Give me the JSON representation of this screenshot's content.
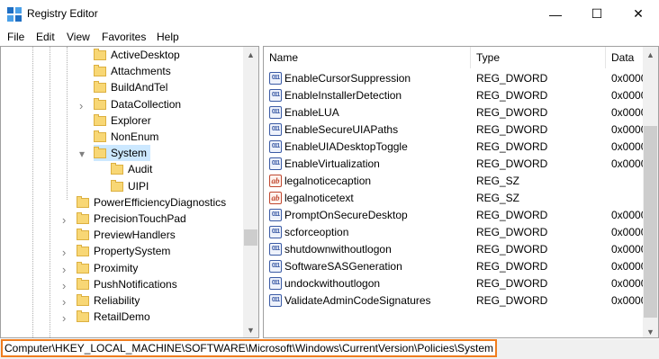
{
  "window": {
    "title": "Registry Editor",
    "minimize_glyph": "—",
    "maximize_glyph": "☐",
    "close_glyph": "✕"
  },
  "menu": [
    "File",
    "Edit",
    "View",
    "Favorites",
    "Help"
  ],
  "tree": {
    "items": [
      {
        "label": "ActiveDesktop",
        "expander": ""
      },
      {
        "label": "Attachments",
        "expander": ""
      },
      {
        "label": "BuildAndTel",
        "expander": ""
      },
      {
        "label": "DataCollection",
        "expander": ">"
      },
      {
        "label": "Explorer",
        "expander": ""
      },
      {
        "label": "NonEnum",
        "expander": ""
      },
      {
        "label": "System",
        "expander": "v",
        "selected": true
      },
      {
        "label": "Audit",
        "expander": ""
      },
      {
        "label": "UIPI",
        "expander": ""
      },
      {
        "label": "PowerEfficiencyDiagnostics",
        "expander": ""
      },
      {
        "label": "PrecisionTouchPad",
        "expander": ">"
      },
      {
        "label": "PreviewHandlers",
        "expander": ""
      },
      {
        "label": "PropertySystem",
        "expander": ">"
      },
      {
        "label": "Proximity",
        "expander": ">"
      },
      {
        "label": "PushNotifications",
        "expander": ">"
      },
      {
        "label": "Reliability",
        "expander": ">"
      },
      {
        "label": "RetailDemo",
        "expander": ">"
      }
    ]
  },
  "list": {
    "columns": [
      "Name",
      "Type",
      "Data"
    ],
    "rows": [
      {
        "name": "EnableCursorSuppression",
        "type": "REG_DWORD",
        "data": "0x0000",
        "icon": "dword"
      },
      {
        "name": "EnableInstallerDetection",
        "type": "REG_DWORD",
        "data": "0x0000",
        "icon": "dword"
      },
      {
        "name": "EnableLUA",
        "type": "REG_DWORD",
        "data": "0x0000",
        "icon": "dword"
      },
      {
        "name": "EnableSecureUIAPaths",
        "type": "REG_DWORD",
        "data": "0x0000",
        "icon": "dword"
      },
      {
        "name": "EnableUIADesktopToggle",
        "type": "REG_DWORD",
        "data": "0x0000",
        "icon": "dword"
      },
      {
        "name": "EnableVirtualization",
        "type": "REG_DWORD",
        "data": "0x0000",
        "icon": "dword"
      },
      {
        "name": "legalnoticecaption",
        "type": "REG_SZ",
        "data": "",
        "icon": "sz"
      },
      {
        "name": "legalnoticetext",
        "type": "REG_SZ",
        "data": "",
        "icon": "sz"
      },
      {
        "name": "PromptOnSecureDesktop",
        "type": "REG_DWORD",
        "data": "0x0000",
        "icon": "dword"
      },
      {
        "name": "scforceoption",
        "type": "REG_DWORD",
        "data": "0x0000",
        "icon": "dword"
      },
      {
        "name": "shutdownwithoutlogon",
        "type": "REG_DWORD",
        "data": "0x0000",
        "icon": "dword"
      },
      {
        "name": "SoftwareSASGeneration",
        "type": "REG_DWORD",
        "data": "0x0000",
        "icon": "dword"
      },
      {
        "name": "undockwithoutlogon",
        "type": "REG_DWORD",
        "data": "0x0000",
        "icon": "dword"
      },
      {
        "name": "ValidateAdminCodeSignatures",
        "type": "REG_DWORD",
        "data": "0x0000",
        "icon": "dword"
      }
    ],
    "dword_icon_text": "011",
    "sz_icon_text": "ab"
  },
  "status": {
    "path": "Computer\\HKEY_LOCAL_MACHINE\\SOFTWARE\\Microsoft\\Windows\\CurrentVersion\\Policies\\System"
  },
  "colors": {
    "selection": "#cce8ff",
    "highlight_border": "#f07d1e"
  }
}
